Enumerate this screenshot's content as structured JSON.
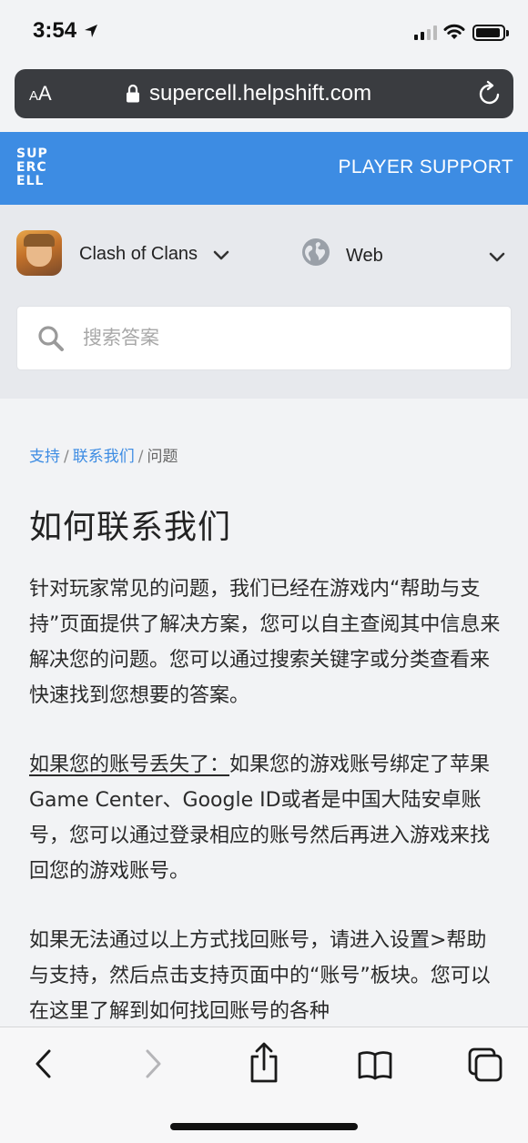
{
  "status": {
    "time": "3:54"
  },
  "browser": {
    "aa_label": "AA",
    "url": "supercell.helpshift.com"
  },
  "header": {
    "logo_lines": [
      "SUP",
      "ERC",
      "ELL"
    ],
    "player_support": "PLAYER SUPPORT",
    "accent_color": "#3d8ce3"
  },
  "selectors": {
    "game": "Clash of Clans",
    "platform": "Web"
  },
  "search": {
    "placeholder": "搜索答案"
  },
  "breadcrumb": {
    "items": [
      "支持",
      "联系我们",
      "问题"
    ],
    "separator": "/"
  },
  "article": {
    "title": "如何联系我们",
    "p1": "针对玩家常见的问题，我们已经在游戏内“帮助与支持”页面提供了解决方案，您可以自主查阅其中信息来解决您的问题。您可以通过搜索关键字或分类查看来快速找到您想要的答案。",
    "p2_underlined": "如果您的账号丢失了：",
    "p2_rest": "如果您的游戏账号绑定了苹果Game Center、Google ID或者是中国大陆安卓账号，您可以通过登录相应的账号然后再进入游戏来找回您的游戏账号。",
    "p3": "如果无法通过以上方式找回账号，请进入设置>帮助与支持，然后点击支持页面中的“账号”板块。您可以在这里了解到如何找回账号的各种"
  },
  "toolbar": {
    "icons": [
      "back-icon",
      "forward-icon",
      "share-icon",
      "bookmarks-icon",
      "tabs-icon"
    ]
  }
}
